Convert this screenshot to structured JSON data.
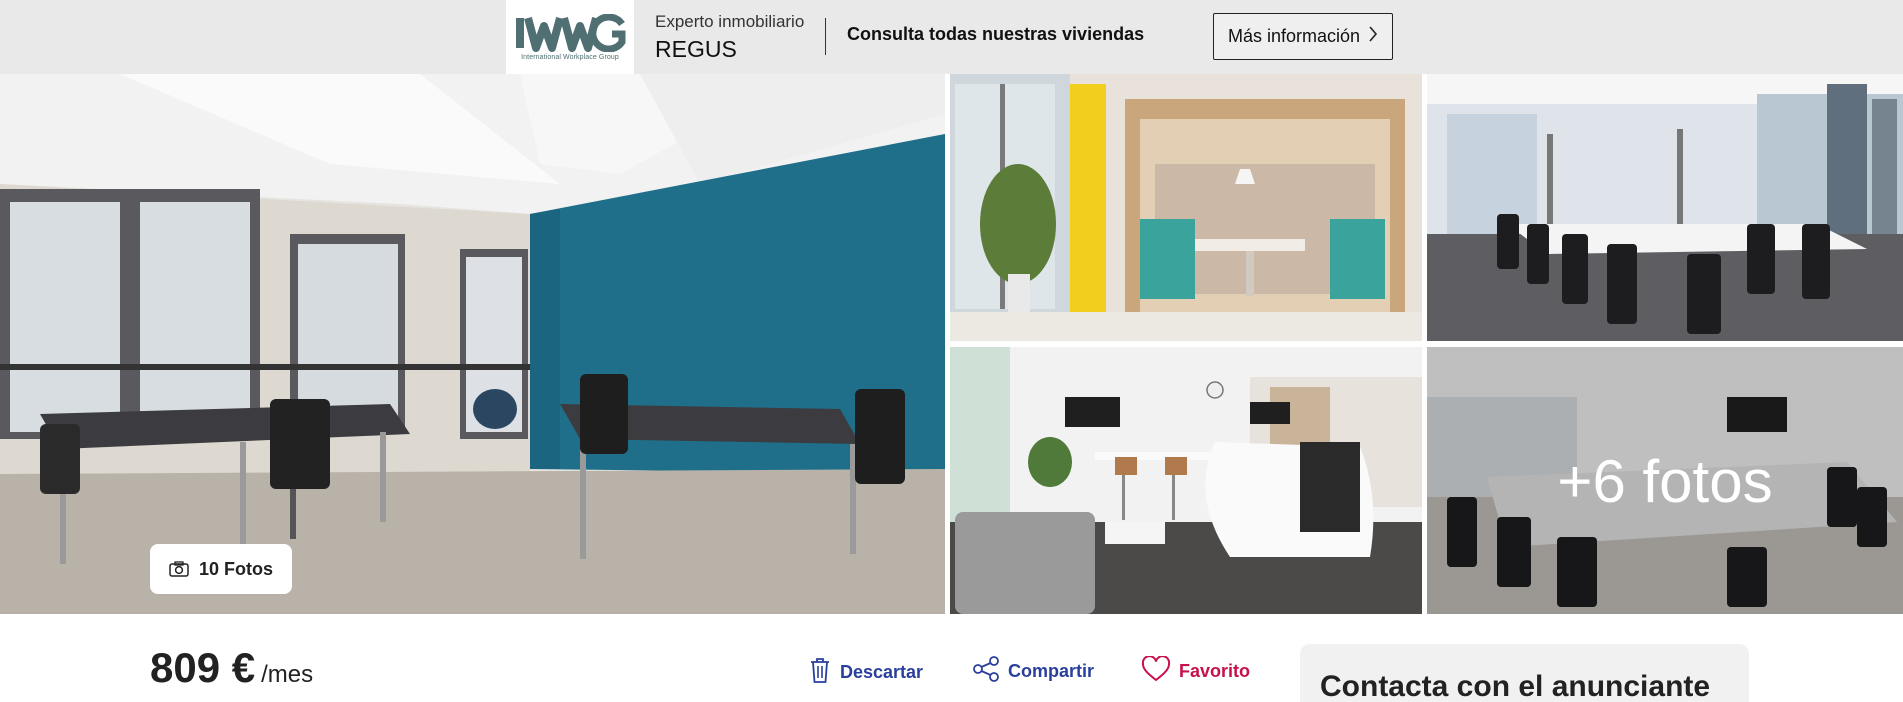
{
  "banner": {
    "logo_text": "IWG",
    "logo_tagline": "International Workplace Group",
    "expert_label": "Experto inmobiliario",
    "agency_name": "REGUS",
    "consulta_text": "Consulta todas nuestras viviendas",
    "more_info_label": "Más información",
    "more_info_icon": "chevron-right-icon"
  },
  "gallery": {
    "photo_count_label": "10 Fotos",
    "photo_count_icon": "camera-icon",
    "more_photos_label": "+6 fotos"
  },
  "listing": {
    "price": "809 €",
    "price_unit": "/mes"
  },
  "actions": {
    "discard_label": "Descartar",
    "share_label": "Compartir",
    "favorite_label": "Favorito"
  },
  "contact": {
    "title": "Contacta con el anunciante"
  },
  "colors": {
    "action_blue": "#2a3f9c",
    "favorite_red": "#c8104a",
    "topbar_bg": "#e9e9e9",
    "logo_teal": "#4f6f73"
  }
}
